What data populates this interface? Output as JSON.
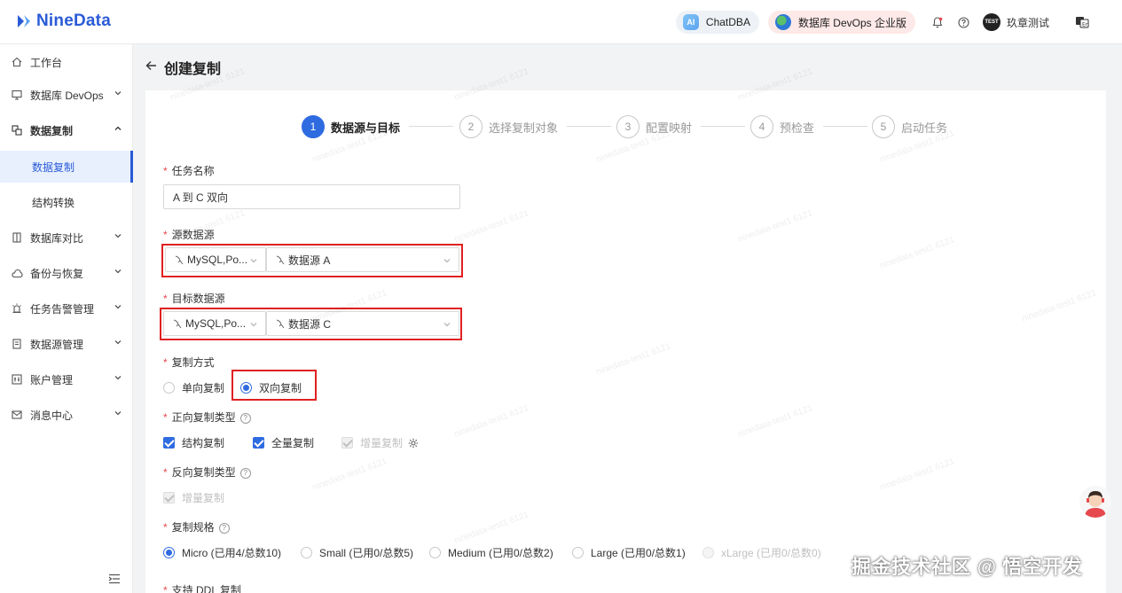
{
  "app": {
    "logo_text": "NineData",
    "brand_color": "#2a5bd7",
    "accent_color": "#2f6be0",
    "highlight_color": "#e02020"
  },
  "topbar": {
    "chatdba_badge": "AI",
    "chatdba_label": "ChatDBA",
    "devops_label": "数据库 DevOps 企业版",
    "avatar_text": "TEST",
    "username": "玖章测试"
  },
  "sidebar": {
    "items": [
      {
        "label": "工作台"
      },
      {
        "label": "数据库 DevOps"
      },
      {
        "label": "数据复制"
      },
      {
        "label": "数据复制"
      },
      {
        "label": "结构转换"
      },
      {
        "label": "数据库对比"
      },
      {
        "label": "备份与恢复"
      },
      {
        "label": "任务告警管理"
      },
      {
        "label": "数据源管理"
      },
      {
        "label": "账户管理"
      },
      {
        "label": "消息中心"
      }
    ]
  },
  "page": {
    "title": "创建复制"
  },
  "steps": [
    {
      "num": "1",
      "label": "数据源与目标"
    },
    {
      "num": "2",
      "label": "选择复制对象"
    },
    {
      "num": "3",
      "label": "配置映射"
    },
    {
      "num": "4",
      "label": "预检查"
    },
    {
      "num": "5",
      "label": "启动任务"
    }
  ],
  "form": {
    "task_name_label": "任务名称",
    "task_name_value": "A 到 C 双向",
    "source_label": "源数据源",
    "source_type": "MySQL,Po...",
    "source_ds": "数据源 A",
    "target_label": "目标数据源",
    "target_type": "MySQL,Po...",
    "target_ds": "数据源 C",
    "method_label": "复制方式",
    "method_options": [
      "单向复制",
      "双向复制"
    ],
    "forward_label": "正向复制类型",
    "forward_options": [
      "结构复制",
      "全量复制",
      "增量复制"
    ],
    "reverse_label": "反向复制类型",
    "reverse_options": [
      "增量复制"
    ],
    "spec_label": "复制规格",
    "spec_options": [
      "Micro (已用4/总数10)",
      "Small (已用0/总数5)",
      "Medium (已用0/总数2)",
      "Large (已用0/总数1)",
      "xLarge (已用0/总数0)"
    ],
    "ddl_label": "支持 DDL 复制"
  },
  "watermark_text": "ninedata-test1 6121",
  "footer_watermark": "掘金技术社区 @ 悟空开发"
}
